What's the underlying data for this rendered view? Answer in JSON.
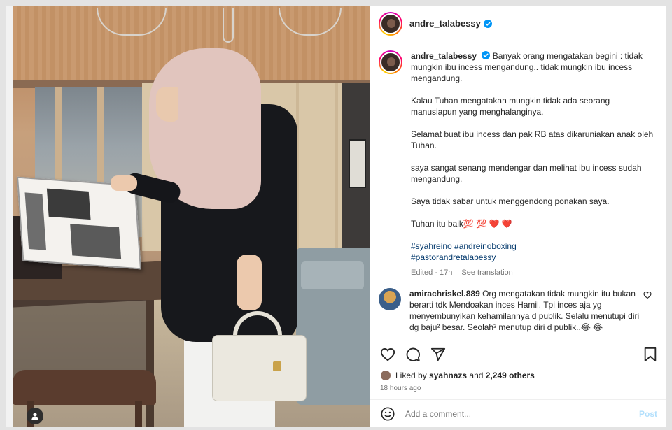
{
  "post": {
    "author": {
      "username": "andre_talabessy",
      "verified": true
    }
  },
  "caption": {
    "username": "andre_talabessy",
    "paragraphs": [
      "Banyak orang mengatakan begini : tidak mungkin ibu incess mengandung.. tidak mungkin ibu incess mengandung.",
      "Kalau Tuhan mengatakan mungkin tidak ada seorang manusiapun yang menghalanginya.",
      "Selamat buat ibu incess dan pak RB atas dikaruniakan anak oleh Tuhan.",
      "saya sangat senang mendengar dan melihat ibu incess sudah mengandung.",
      "Saya tidak sabar untuk menggendong ponakan saya.",
      "Tuhan itu baik💯 💯 ❤️ ❤️"
    ],
    "hashtags": [
      "#syahreino #andreinoboxing",
      "#pastorandretalabessy"
    ],
    "edited": "Edited · 17h",
    "see_translation": "See translation"
  },
  "comments": [
    {
      "username": "amirachriskel.889",
      "text": "Org mengatakan tidak mungkin itu bukan berarti tdk Mendoakan inces Hamil. Tpi inces aja yg menyembunyikan kehamilannya d publik. Selalu menutupi diri dg baju² besar. Seolah² menutup diri d publik..😂 😂"
    }
  ],
  "likes": {
    "prefix": "Liked by",
    "user": "syahnazs",
    "and": "and",
    "others": "2,249 others"
  },
  "time_ago": "18 hours ago",
  "comment_box": {
    "placeholder": "Add a comment...",
    "post_label": "Post"
  },
  "icons": {
    "like": "heart-icon",
    "comment": "comment-icon",
    "share": "send-icon",
    "save": "bookmark-icon",
    "emoji": "emoji-icon",
    "tagged_user": "user-icon"
  },
  "colors": {
    "hashtag": "#00376b",
    "verified": "#0095f6",
    "post_disabled": "#b2dffc"
  }
}
